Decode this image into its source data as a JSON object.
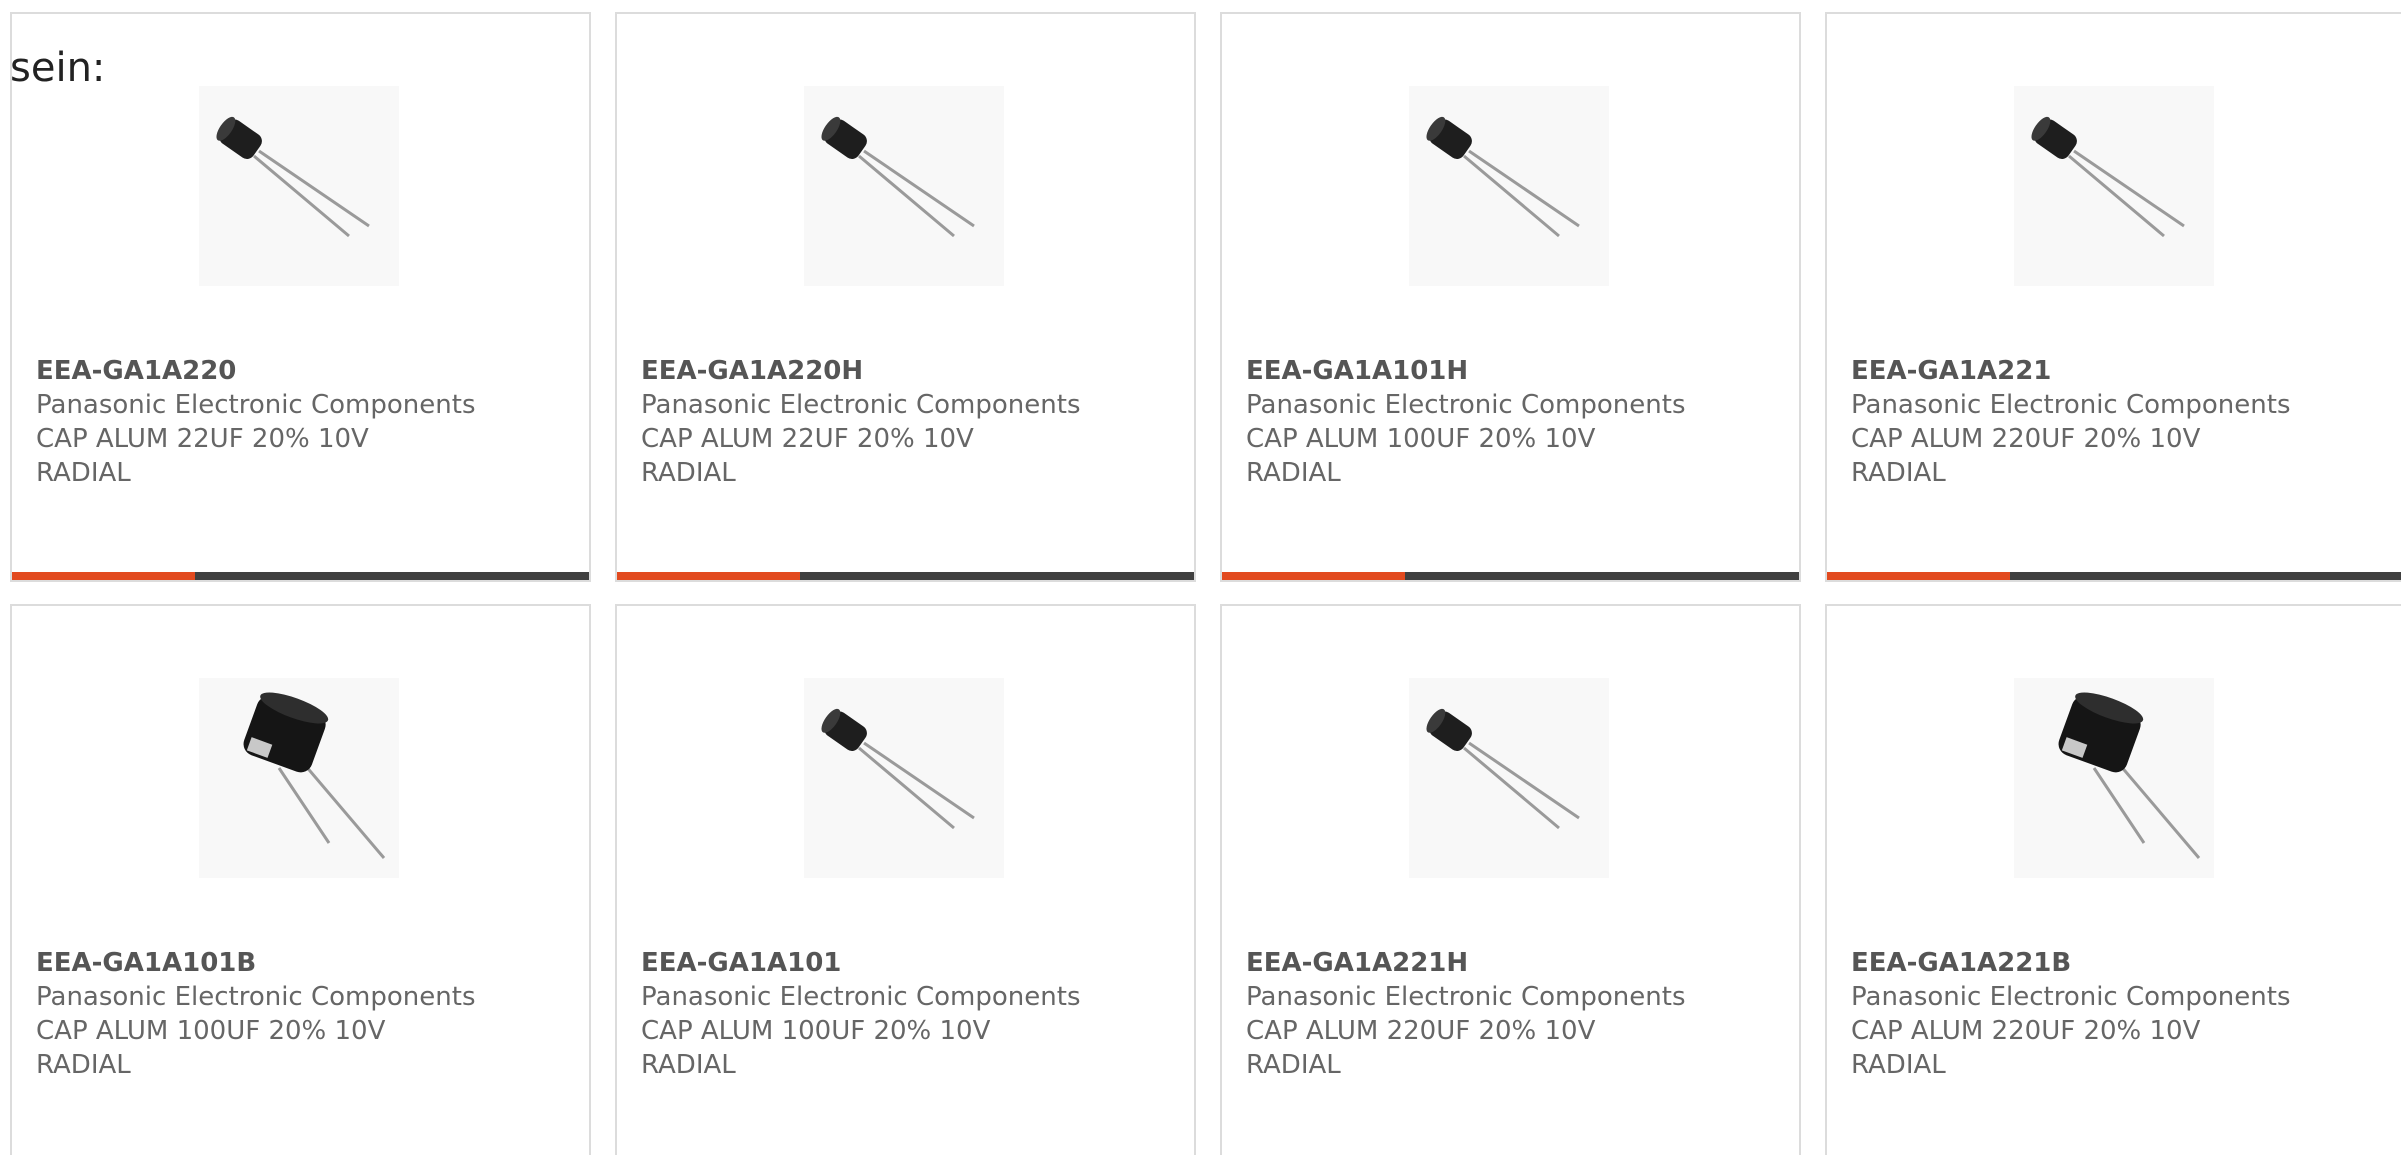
{
  "intro_text": "sein:",
  "colors": {
    "accent": "#e24a1f",
    "bar": "#404040",
    "border": "#dcdcdc",
    "text": "#666666"
  },
  "products": [
    {
      "part_number": "EEA-GA1A220",
      "manufacturer": "Panasonic Electronic Components",
      "description_line1": "CAP ALUM 22UF 20% 10V",
      "description_line2": "RADIAL",
      "image_icon": "small-radial-capacitor-icon"
    },
    {
      "part_number": "EEA-GA1A220H",
      "manufacturer": "Panasonic Electronic Components",
      "description_line1": "CAP ALUM 22UF 20% 10V",
      "description_line2": "RADIAL",
      "image_icon": "small-radial-capacitor-icon"
    },
    {
      "part_number": "EEA-GA1A101H",
      "manufacturer": "Panasonic Electronic Components",
      "description_line1": "CAP ALUM 100UF 20% 10V",
      "description_line2": "RADIAL",
      "image_icon": "small-radial-capacitor-icon"
    },
    {
      "part_number": "EEA-GA1A221",
      "manufacturer": "Panasonic Electronic Components",
      "description_line1": "CAP ALUM 220UF 20% 10V",
      "description_line2": "RADIAL",
      "image_icon": "small-radial-capacitor-icon"
    },
    {
      "part_number": "EEA-GA1A101B",
      "manufacturer": "Panasonic Electronic Components",
      "description_line1": "CAP ALUM 100UF 20% 10V",
      "description_line2": "RADIAL",
      "image_icon": "large-radial-capacitor-icon"
    },
    {
      "part_number": "EEA-GA1A101",
      "manufacturer": "Panasonic Electronic Components",
      "description_line1": "CAP ALUM 100UF 20% 10V",
      "description_line2": "RADIAL",
      "image_icon": "small-radial-capacitor-icon"
    },
    {
      "part_number": "EEA-GA1A221H",
      "manufacturer": "Panasonic Electronic Components",
      "description_line1": "CAP ALUM 220UF 20% 10V",
      "description_line2": "RADIAL",
      "image_icon": "small-radial-capacitor-icon"
    },
    {
      "part_number": "EEA-GA1A221B",
      "manufacturer": "Panasonic Electronic Components",
      "description_line1": "CAP ALUM 220UF 20% 10V",
      "description_line2": "RADIAL",
      "image_icon": "large-radial-capacitor-icon"
    }
  ]
}
